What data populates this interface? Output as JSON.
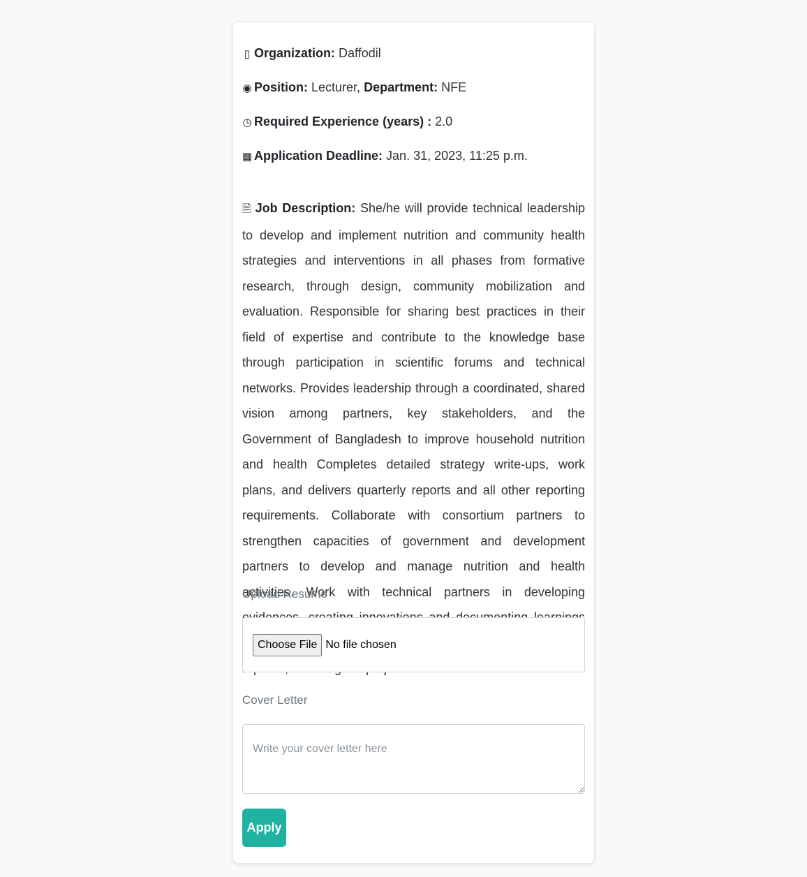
{
  "job": {
    "organization": {
      "icon": "building-icon",
      "label": "Organization:",
      "value": "Daffodil"
    },
    "position": {
      "icon": "target-icon",
      "label": "Position:",
      "value": "Lecturer,",
      "department_label": "Department:",
      "department_value": "NFE"
    },
    "experience": {
      "icon": "clock-icon",
      "label": "Required Experience (years) :",
      "value": "2.0"
    },
    "deadline": {
      "icon": "calendar-icon",
      "label": "Application Deadline:",
      "value": "Jan. 31, 2023, 11:25 p.m."
    },
    "description": {
      "icon": "file-icon",
      "label": "Job Description:",
      "text": "She/he will provide technical leadership to develop and implement nutrition and community health strategies and interventions in all phases from formative research, through design, community mobilization and evaluation. Responsible for sharing best practices in their field of expertise and contribute to the knowledge base through participation in scientific forums and technical networks. Provides leadership through a coordinated, shared vision among partners, key stakeholders, and the Government of Bangladesh to improve household nutrition and health Completes detailed strategy write-ups, work plans, and delivers quarterly reports and all other reporting requirements. Collaborate with consortium partners to strengthen capacities of government and development partners to develop and manage nutrition and health activities. Work with technical partners in developing evidences, creating innovations and documenting learnings for advocacy and scale-up Mentor and supervise direct report/s, including the project technical leads."
    }
  },
  "form": {
    "resume_label": "Upload Resume",
    "choose_file_label": "Choose File",
    "file_status": "No file chosen",
    "cover_label": "Cover Letter",
    "cover_placeholder": "Write your cover letter here",
    "apply_label": "Apply"
  },
  "colors": {
    "apply_button": "#20b2a0",
    "background": "#f8f9fa"
  }
}
